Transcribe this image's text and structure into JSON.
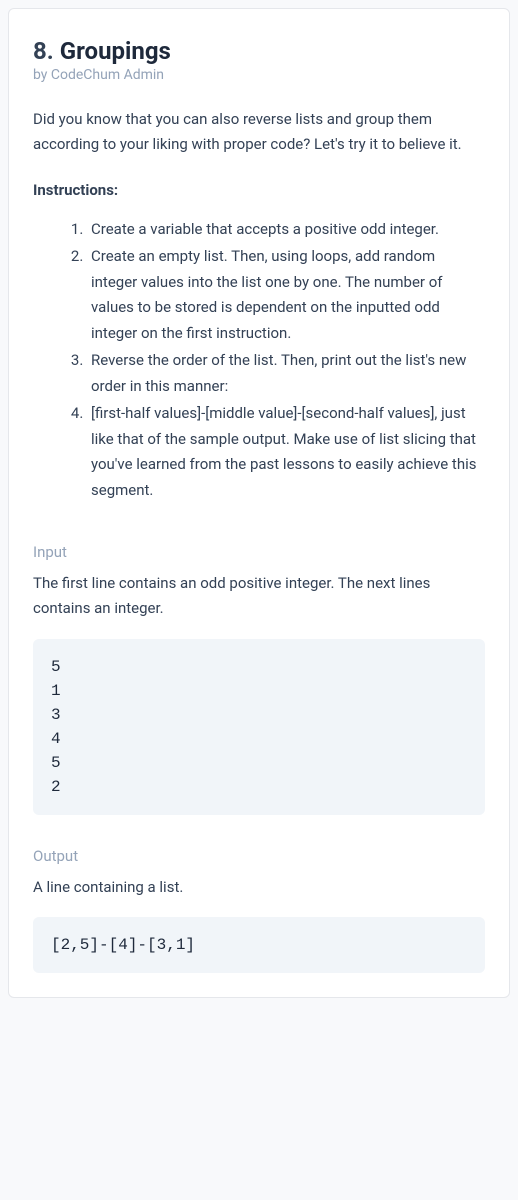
{
  "title": {
    "number": "8.",
    "text": "Groupings"
  },
  "byline": "by CodeChum Admin",
  "intro": "Did you know that you can also reverse lists and group them according to your liking with proper code? Let's try it to believe it.",
  "instructions_label": "Instructions:",
  "instructions": [
    "Create a variable that accepts a positive odd integer.",
    "Create an empty list. Then, using loops, add random integer values into the list one by one. The number of values to be stored is dependent on the inputted odd integer on the first instruction.",
    "Reverse the order of the list. Then, print out the list's new order in this manner:",
    "[first-half values]-[middle value]-[second-half values], just like that of the sample output. Make use of list slicing that you've learned from the past lessons to easily achieve this segment."
  ],
  "input": {
    "label": "Input",
    "desc": "The first line contains an odd positive integer. The next lines contains an integer.",
    "code": "5\n1\n3\n4\n5\n2"
  },
  "output": {
    "label": "Output",
    "desc": "A line containing a list.",
    "code": "[2,5]-[4]-[3,1]"
  }
}
